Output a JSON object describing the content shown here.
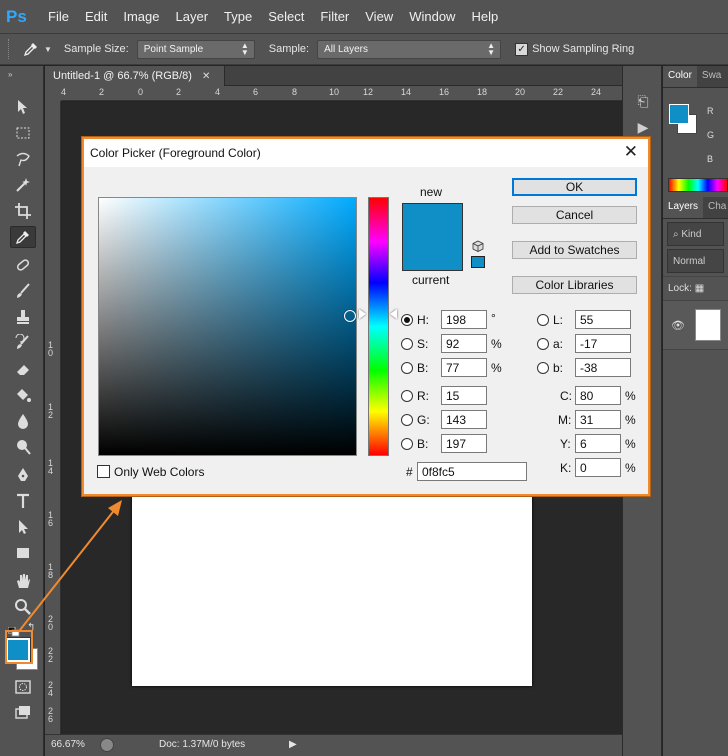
{
  "menubar": {
    "logo": "Ps",
    "items": [
      "File",
      "Edit",
      "Image",
      "Layer",
      "Type",
      "Select",
      "Filter",
      "View",
      "Window",
      "Help"
    ]
  },
  "options": {
    "sample_size_label": "Sample Size:",
    "sample_size_value": "Point Sample",
    "sample_label": "Sample:",
    "sample_value": "All Layers",
    "show_ring_label": "Show Sampling Ring",
    "show_ring_checked": true
  },
  "document": {
    "tab_title": "Untitled-1 @ 66.7% (RGB/8)",
    "ruler_top": [
      "4",
      "2",
      "0",
      "2",
      "4",
      "6",
      "8",
      "10",
      "12",
      "14",
      "16",
      "18",
      "20",
      "22",
      "24"
    ],
    "ruler_left": [
      "1",
      "0",
      "1",
      "2",
      "1",
      "4",
      "1",
      "6",
      "1",
      "8",
      "2",
      "0",
      "2",
      "2",
      "2",
      "4",
      "2",
      "6"
    ]
  },
  "status": {
    "zoom": "66.67%",
    "doc": "Doc: 1.37M/0 bytes"
  },
  "panels": {
    "color_tab": "Color",
    "swatches_tab": "Swa",
    "channel_r": "R",
    "channel_g": "G",
    "channel_b": "B",
    "layers_tab": "Layers",
    "channels_tab": "Cha",
    "kind_label": "Kind",
    "blend_mode": "Normal",
    "lock_label": "Lock:"
  },
  "colors": {
    "foreground": "#0f8fc5",
    "accent_annotation": "#f08a2f"
  },
  "dialog": {
    "title": "Color Picker (Foreground Color)",
    "new_label": "new",
    "current_label": "current",
    "ok": "OK",
    "cancel": "Cancel",
    "add_to_swatches": "Add to Swatches",
    "color_libraries": "Color Libraries",
    "only_web_colors": "Only Web Colors",
    "hsb": {
      "h_label": "H:",
      "h": "198",
      "h_unit": "°",
      "s_label": "S:",
      "s": "92",
      "s_unit": "%",
      "b_label": "B:",
      "b": "77",
      "b_unit": "%"
    },
    "rgb": {
      "r_label": "R:",
      "r": "15",
      "g_label": "G:",
      "g": "143",
      "b_label": "B:",
      "b": "197"
    },
    "lab": {
      "l_label": "L:",
      "l": "55",
      "a_label": "a:",
      "a": "-17",
      "b_label": "b:",
      "b": "-38"
    },
    "cmyk": {
      "c_label": "C:",
      "c": "80",
      "m_label": "M:",
      "m": "31",
      "y_label": "Y:",
      "y": "6",
      "k_label": "K:",
      "k": "0",
      "unit": "%"
    },
    "hex_label": "#",
    "hex": "0f8fc5"
  }
}
